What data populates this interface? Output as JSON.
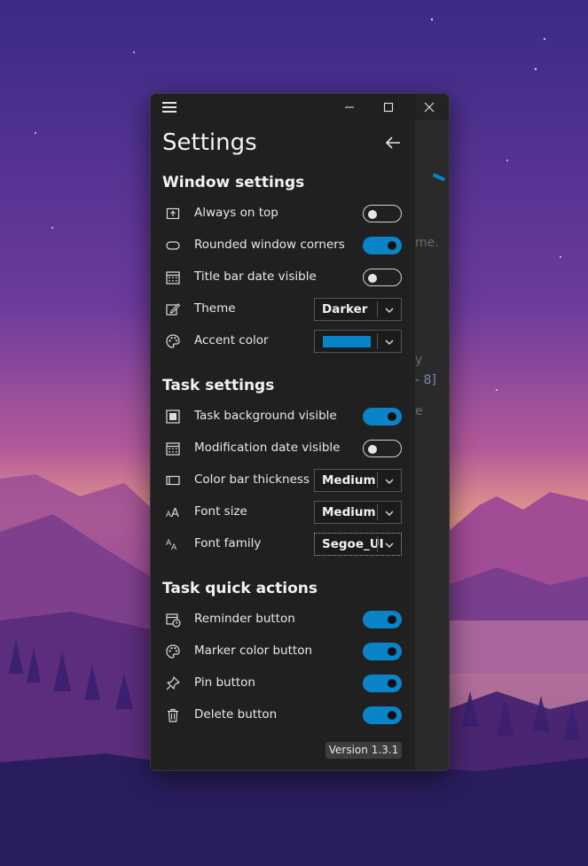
{
  "window": {
    "title": "Settings"
  },
  "sections": {
    "window": "Window settings",
    "task": "Task settings",
    "quick": "Task quick actions"
  },
  "window_settings": [
    {
      "label": "Always on top",
      "icon": "pin-window-icon",
      "control": "toggle",
      "on": false
    },
    {
      "label": "Rounded window corners",
      "icon": "rounded-rectangle-icon",
      "control": "toggle",
      "on": true
    },
    {
      "label": "Title bar date visible",
      "icon": "calendar-icon",
      "control": "toggle",
      "on": false
    },
    {
      "label": "Theme",
      "icon": "edit-theme-icon",
      "control": "select",
      "value": "Darker"
    },
    {
      "label": "Accent color",
      "icon": "palette-icon",
      "control": "color",
      "color": "#0A84C8"
    }
  ],
  "task_settings": [
    {
      "label": "Task background visible",
      "icon": "filled-square-icon",
      "control": "toggle",
      "on": true
    },
    {
      "label": "Modification date visible",
      "icon": "calendar-icon",
      "control": "toggle",
      "on": false
    },
    {
      "label": "Color bar thickness",
      "icon": "color-bar-icon",
      "control": "select",
      "value": "Medium"
    },
    {
      "label": "Font size",
      "icon": "font-size-icon",
      "control": "select",
      "value": "Medium"
    },
    {
      "label": "Font family",
      "icon": "font-family-icon",
      "control": "select",
      "value": "Segoe_UI"
    }
  ],
  "quick_actions": [
    {
      "label": "Reminder button",
      "icon": "reminder-calendar-icon",
      "control": "toggle",
      "on": true
    },
    {
      "label": "Marker color button",
      "icon": "palette-icon",
      "control": "toggle",
      "on": true
    },
    {
      "label": "Pin button",
      "icon": "pin-icon",
      "control": "toggle",
      "on": true
    },
    {
      "label": "Delete button",
      "icon": "trash-icon",
      "control": "toggle",
      "on": true
    }
  ],
  "version": "Version 1.3.1",
  "background_peek": {
    "fragment_1": "me.",
    "fragment_2": "y",
    "fragment_3": "- 8]",
    "fragment_4": "e"
  },
  "colors": {
    "accent": "#0A84C8",
    "panel": "#202020"
  }
}
